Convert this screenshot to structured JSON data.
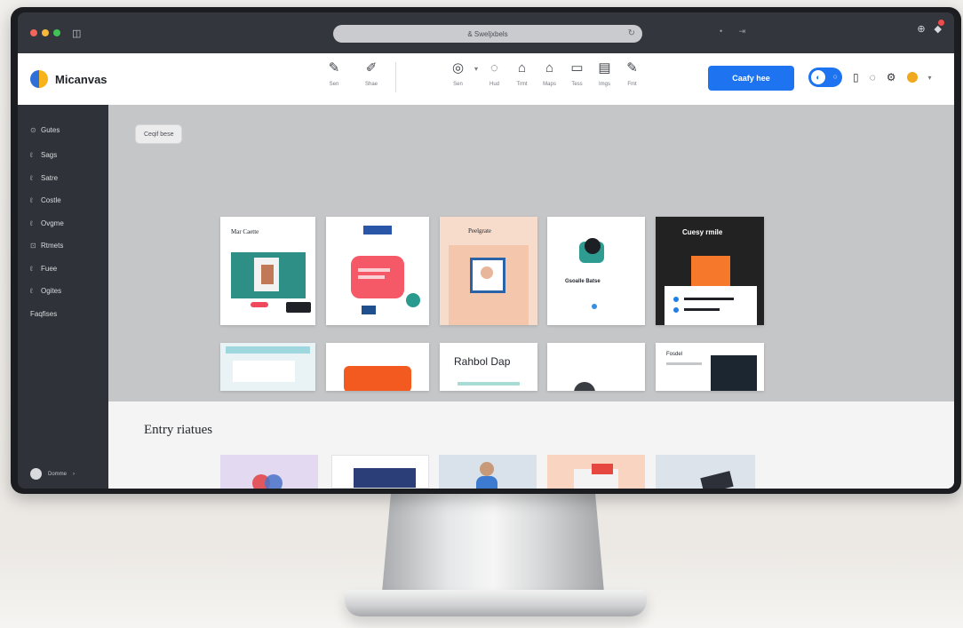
{
  "browser": {
    "url": "& Sweljxbels",
    "refresh_icon": "refresh-icon"
  },
  "app": {
    "name": "Micanvas",
    "tools_left": [
      {
        "icon": "pen-icon",
        "glyph": "✎",
        "label": "Sen"
      },
      {
        "icon": "brush-icon",
        "glyph": "✐",
        "label": "Shae"
      }
    ],
    "tools_right": [
      {
        "icon": "shape-icon",
        "glyph": "◎",
        "label": "Sen"
      },
      {
        "icon": "lasso-icon",
        "glyph": "◌",
        "label": "Hud"
      },
      {
        "icon": "text-icon",
        "glyph": "⌂",
        "label": "Trmt"
      },
      {
        "icon": "frame-icon",
        "glyph": "⌂",
        "label": "Maps"
      },
      {
        "icon": "layer-icon",
        "glyph": "▭",
        "label": "Tess"
      },
      {
        "icon": "image-icon",
        "glyph": "▤",
        "label": "Imgs"
      },
      {
        "icon": "draw-icon",
        "glyph": "✎",
        "label": "Fmt"
      }
    ],
    "create_button": "Caafy hee"
  },
  "sidebar": {
    "items": [
      {
        "icon": "⊙",
        "label": "Gutes"
      },
      {
        "icon": "ℓ",
        "label": "Sags"
      },
      {
        "icon": "ℓ",
        "label": "Satre"
      },
      {
        "icon": "ℓ",
        "label": "Costle"
      },
      {
        "icon": "ℓ",
        "label": "Ovgme"
      },
      {
        "icon": "⊡",
        "label": "Rtmets"
      },
      {
        "icon": "ℓ",
        "label": "Fuee"
      },
      {
        "icon": "ℓ",
        "label": "Ogites"
      },
      {
        "icon": "",
        "label": "Faqfises"
      }
    ],
    "user_label": "Domme"
  },
  "main": {
    "chip": "Ceqif bese",
    "templates_row1": [
      {
        "title": "Mar Caette",
        "bg": "#ffffff"
      },
      {
        "title": "",
        "bg": "#ffffff"
      },
      {
        "title": "Peelgrate",
        "bg": "#f7dccb"
      },
      {
        "title": "Gsoalle Batse",
        "bg": "#ffffff"
      },
      {
        "title": "Cuesy rmile",
        "bg": "#222222"
      }
    ],
    "templates_row2": [
      {
        "title": "",
        "bg": "#e9f3f6"
      },
      {
        "title": "",
        "bg": "#ffffff"
      },
      {
        "title": "Rahbol Dap",
        "bg": "#ffffff"
      },
      {
        "title": "",
        "bg": "#ffffff"
      },
      {
        "title": "Fosdel",
        "bg": "#ffffff"
      }
    ],
    "section_title": "Entry riatues"
  },
  "colors": {
    "accent": "#1e74f0",
    "sidebar": "#2f3238",
    "hero": "#c5c6c8"
  }
}
